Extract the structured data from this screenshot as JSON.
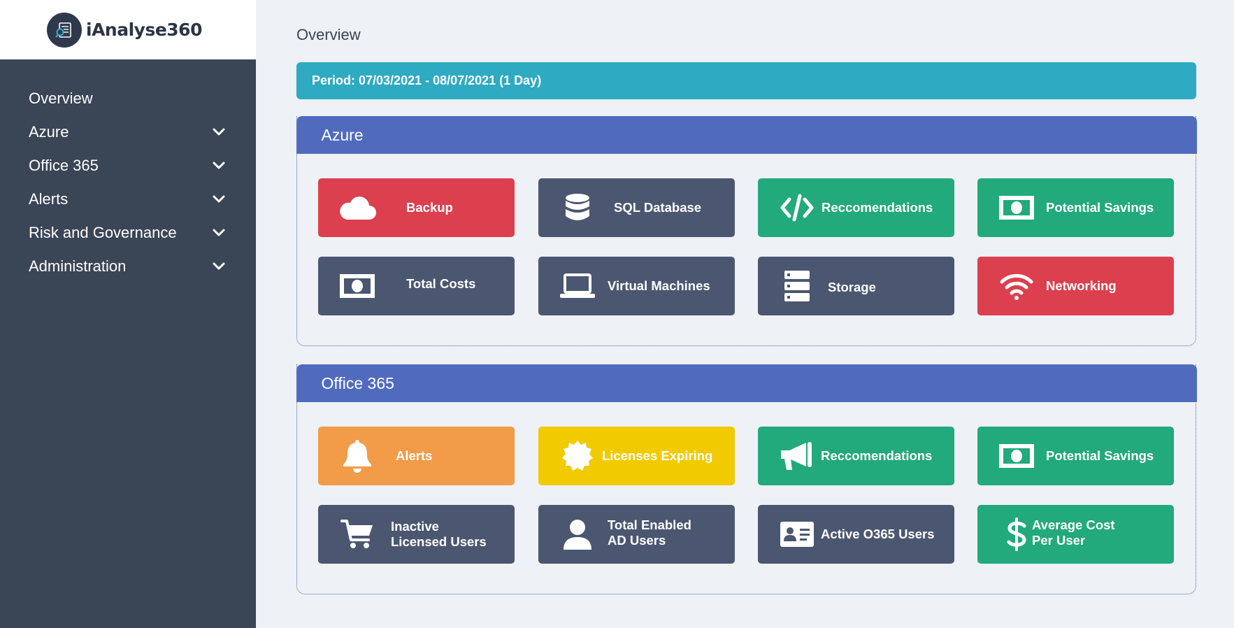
{
  "app": {
    "title": "iAnalyse360"
  },
  "sidebar": {
    "items": [
      {
        "label": "Overview"
      },
      {
        "label": "Azure"
      },
      {
        "label": "Office 365"
      },
      {
        "label": "Alerts"
      },
      {
        "label": "Risk and Governance"
      },
      {
        "label": "Administration"
      }
    ]
  },
  "main": {
    "title": "Overview",
    "period": "Period: 07/03/2021 - 08/07/2021 (1 Day)"
  },
  "azure": {
    "title": "Azure",
    "tiles": [
      {
        "label": "Backup",
        "icon": "cloud-icon",
        "color": "#dc3f4d"
      },
      {
        "label": "SQL Database",
        "icon": "database-icon",
        "color": "#4b5670"
      },
      {
        "label": "Reccomendations",
        "icon": "code-icon",
        "color": "#22a97c"
      },
      {
        "label": "Potential Savings",
        "icon": "money-bill-icon",
        "color": "#22a97c"
      },
      {
        "label": "Total Costs",
        "icon": "money-bill-icon",
        "color": "#4b5670"
      },
      {
        "label": "Virtual Machines",
        "icon": "laptop-icon",
        "color": "#4b5670"
      },
      {
        "label": "Storage",
        "icon": "server-icon",
        "color": "#4b5670"
      },
      {
        "label": "Networking",
        "icon": "wifi-icon",
        "color": "#dc3f4d"
      }
    ]
  },
  "office365": {
    "title": "Office 365",
    "tiles": [
      {
        "label": "Alerts",
        "icon": "bell-icon",
        "color": "#f29b48"
      },
      {
        "label": "Licenses Expiring",
        "icon": "certificate-icon",
        "color": "#f1ca00"
      },
      {
        "label": "Reccomendations",
        "icon": "bullhorn-icon",
        "color": "#22a97c"
      },
      {
        "label": "Potential Savings",
        "icon": "money-bill-icon",
        "color": "#22a97c"
      },
      {
        "label_line1": "Inactive",
        "label_line2": "Licensed Users",
        "icon": "cart-icon",
        "color": "#4b5670"
      },
      {
        "label_line1": "Total Enabled",
        "label_line2": "AD Users",
        "icon": "user-icon",
        "color": "#4b5670"
      },
      {
        "label": "Active O365 Users",
        "icon": "id-card-icon",
        "color": "#4b5670"
      },
      {
        "label_line1": "Average Cost",
        "label_line2": "Per User",
        "icon": "dollar-icon",
        "color": "#22a97c"
      }
    ]
  }
}
